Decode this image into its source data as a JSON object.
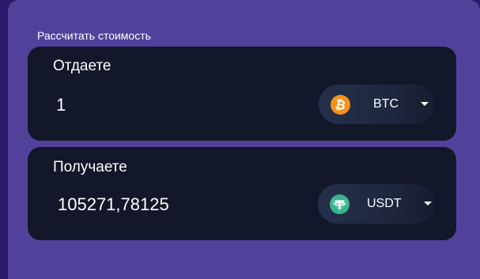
{
  "calculator": {
    "title": "Рассчитать стоимость",
    "give": {
      "label": "Отдаете",
      "amount": "1",
      "currency": "BTC",
      "currency_icon": "bitcoin-icon"
    },
    "get": {
      "label": "Получаете",
      "amount": "105271,78125",
      "currency": "USDT",
      "currency_icon": "tether-icon"
    }
  },
  "colors": {
    "page_background": "#2b1a6b",
    "panel_background": "#52419b",
    "card_background": "#12172a",
    "btc_orange": "#f7931a",
    "usdt_green": "#3bb38f"
  }
}
